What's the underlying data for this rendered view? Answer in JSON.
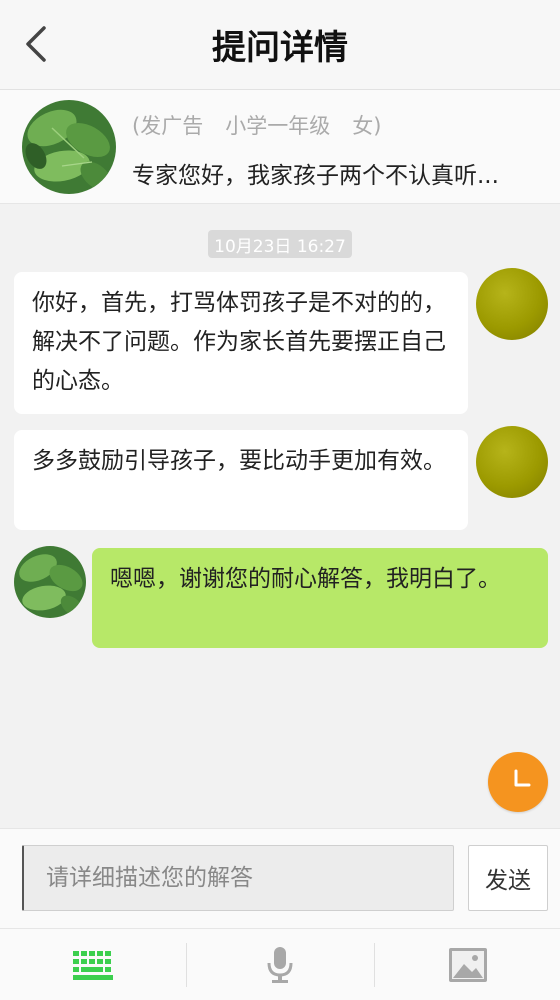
{
  "header": {
    "title": "提问详情",
    "back_icon": "chevron-left-icon"
  },
  "question": {
    "tag": "(发广告",
    "grade": "小学一年级",
    "gender": "女)",
    "text": "专家您好，我家孩子两个不认真听..."
  },
  "chat": {
    "timestamp": "10月23日 16:27",
    "messages": [
      {
        "sender": "expert",
        "text": "你好，首先，打骂体罚孩子是不对的的，解决不了问题。作为家长首先要摆正自己的心态。"
      },
      {
        "sender": "expert",
        "text": "多多鼓励引导孩子，要比动手更加有效。"
      },
      {
        "sender": "user",
        "text": "嗯嗯，谢谢您的耐心解答，我明白了。"
      }
    ]
  },
  "input": {
    "placeholder": "请详细描述您的解答",
    "send_label": "发送"
  },
  "tabs": [
    {
      "name": "keyboard",
      "icon": "keyboard-icon",
      "active": true
    },
    {
      "name": "voice",
      "icon": "microphone-icon",
      "active": false
    },
    {
      "name": "image",
      "icon": "image-icon",
      "active": false
    }
  ],
  "colors": {
    "accent_green": "#3ccf4e",
    "my_bubble": "#b7e868",
    "clock_orange": "#f5941f",
    "expert_avatar": "#9c9a00"
  }
}
